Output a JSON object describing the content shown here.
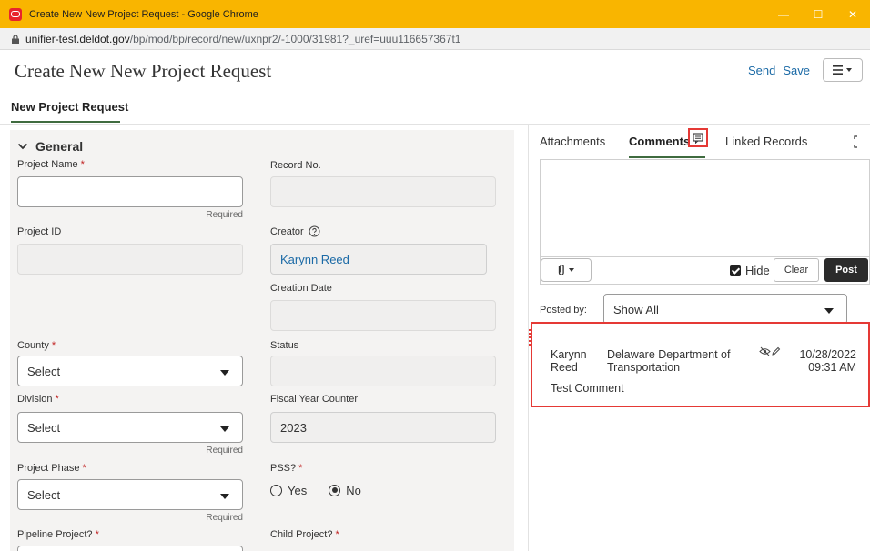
{
  "browser": {
    "window_title": "Create New New Project Request - Google Chrome",
    "url_host": "unifier-test.deldot.gov",
    "url_path": "/bp/mod/bp/record/new/uxnpr2/-1000/31981?_uref=uuu116657367t1",
    "controls": {
      "minimize": "—",
      "maximize": "☐",
      "close": "✕"
    }
  },
  "header": {
    "title": "Create New New Project Request",
    "send_label": "Send",
    "save_label": "Save",
    "tab_label": "New Project Request"
  },
  "form": {
    "section_title": "General",
    "project_name": {
      "label": "Project Name",
      "value": "",
      "hint": "Required"
    },
    "record_no": {
      "label": "Record No.",
      "value": ""
    },
    "project_id": {
      "label": "Project ID",
      "value": ""
    },
    "creator": {
      "label": "Creator",
      "value": "Karynn Reed"
    },
    "creation_date": {
      "label": "Creation Date",
      "value": ""
    },
    "county": {
      "label": "County",
      "value": "Select"
    },
    "status": {
      "label": "Status",
      "value": ""
    },
    "division": {
      "label": "Division",
      "value": "Select",
      "hint": "Required"
    },
    "fiscal_year_counter": {
      "label": "Fiscal Year Counter",
      "value": "2023"
    },
    "project_phase": {
      "label": "Project Phase",
      "value": "Select",
      "hint": "Required"
    },
    "pss": {
      "label": "PSS?",
      "options": [
        "Yes",
        "No"
      ],
      "selected": "No"
    },
    "pipeline_project": {
      "label": "Pipeline Project?"
    },
    "child_project": {
      "label": "Child Project?"
    },
    "required_mark": "*"
  },
  "side": {
    "tabs": [
      "Attachments",
      "Comments",
      "Linked Records"
    ],
    "active_tab": "Comments",
    "hide_label": "Hide",
    "clear_label": "Clear",
    "post_label": "Post",
    "posted_by_label": "Posted by:",
    "posted_by_value": "Show All",
    "comments": [
      {
        "author": "Karynn Reed",
        "organization": "Delaware Department of Transportation",
        "date": "10/28/2022",
        "time": "09:31 AM",
        "text": "Test Comment"
      }
    ]
  },
  "colors": {
    "titlebar": "#f9b500",
    "link": "#1b6aa6",
    "accent": "#3f6b3f",
    "highlight": "#e53935"
  }
}
